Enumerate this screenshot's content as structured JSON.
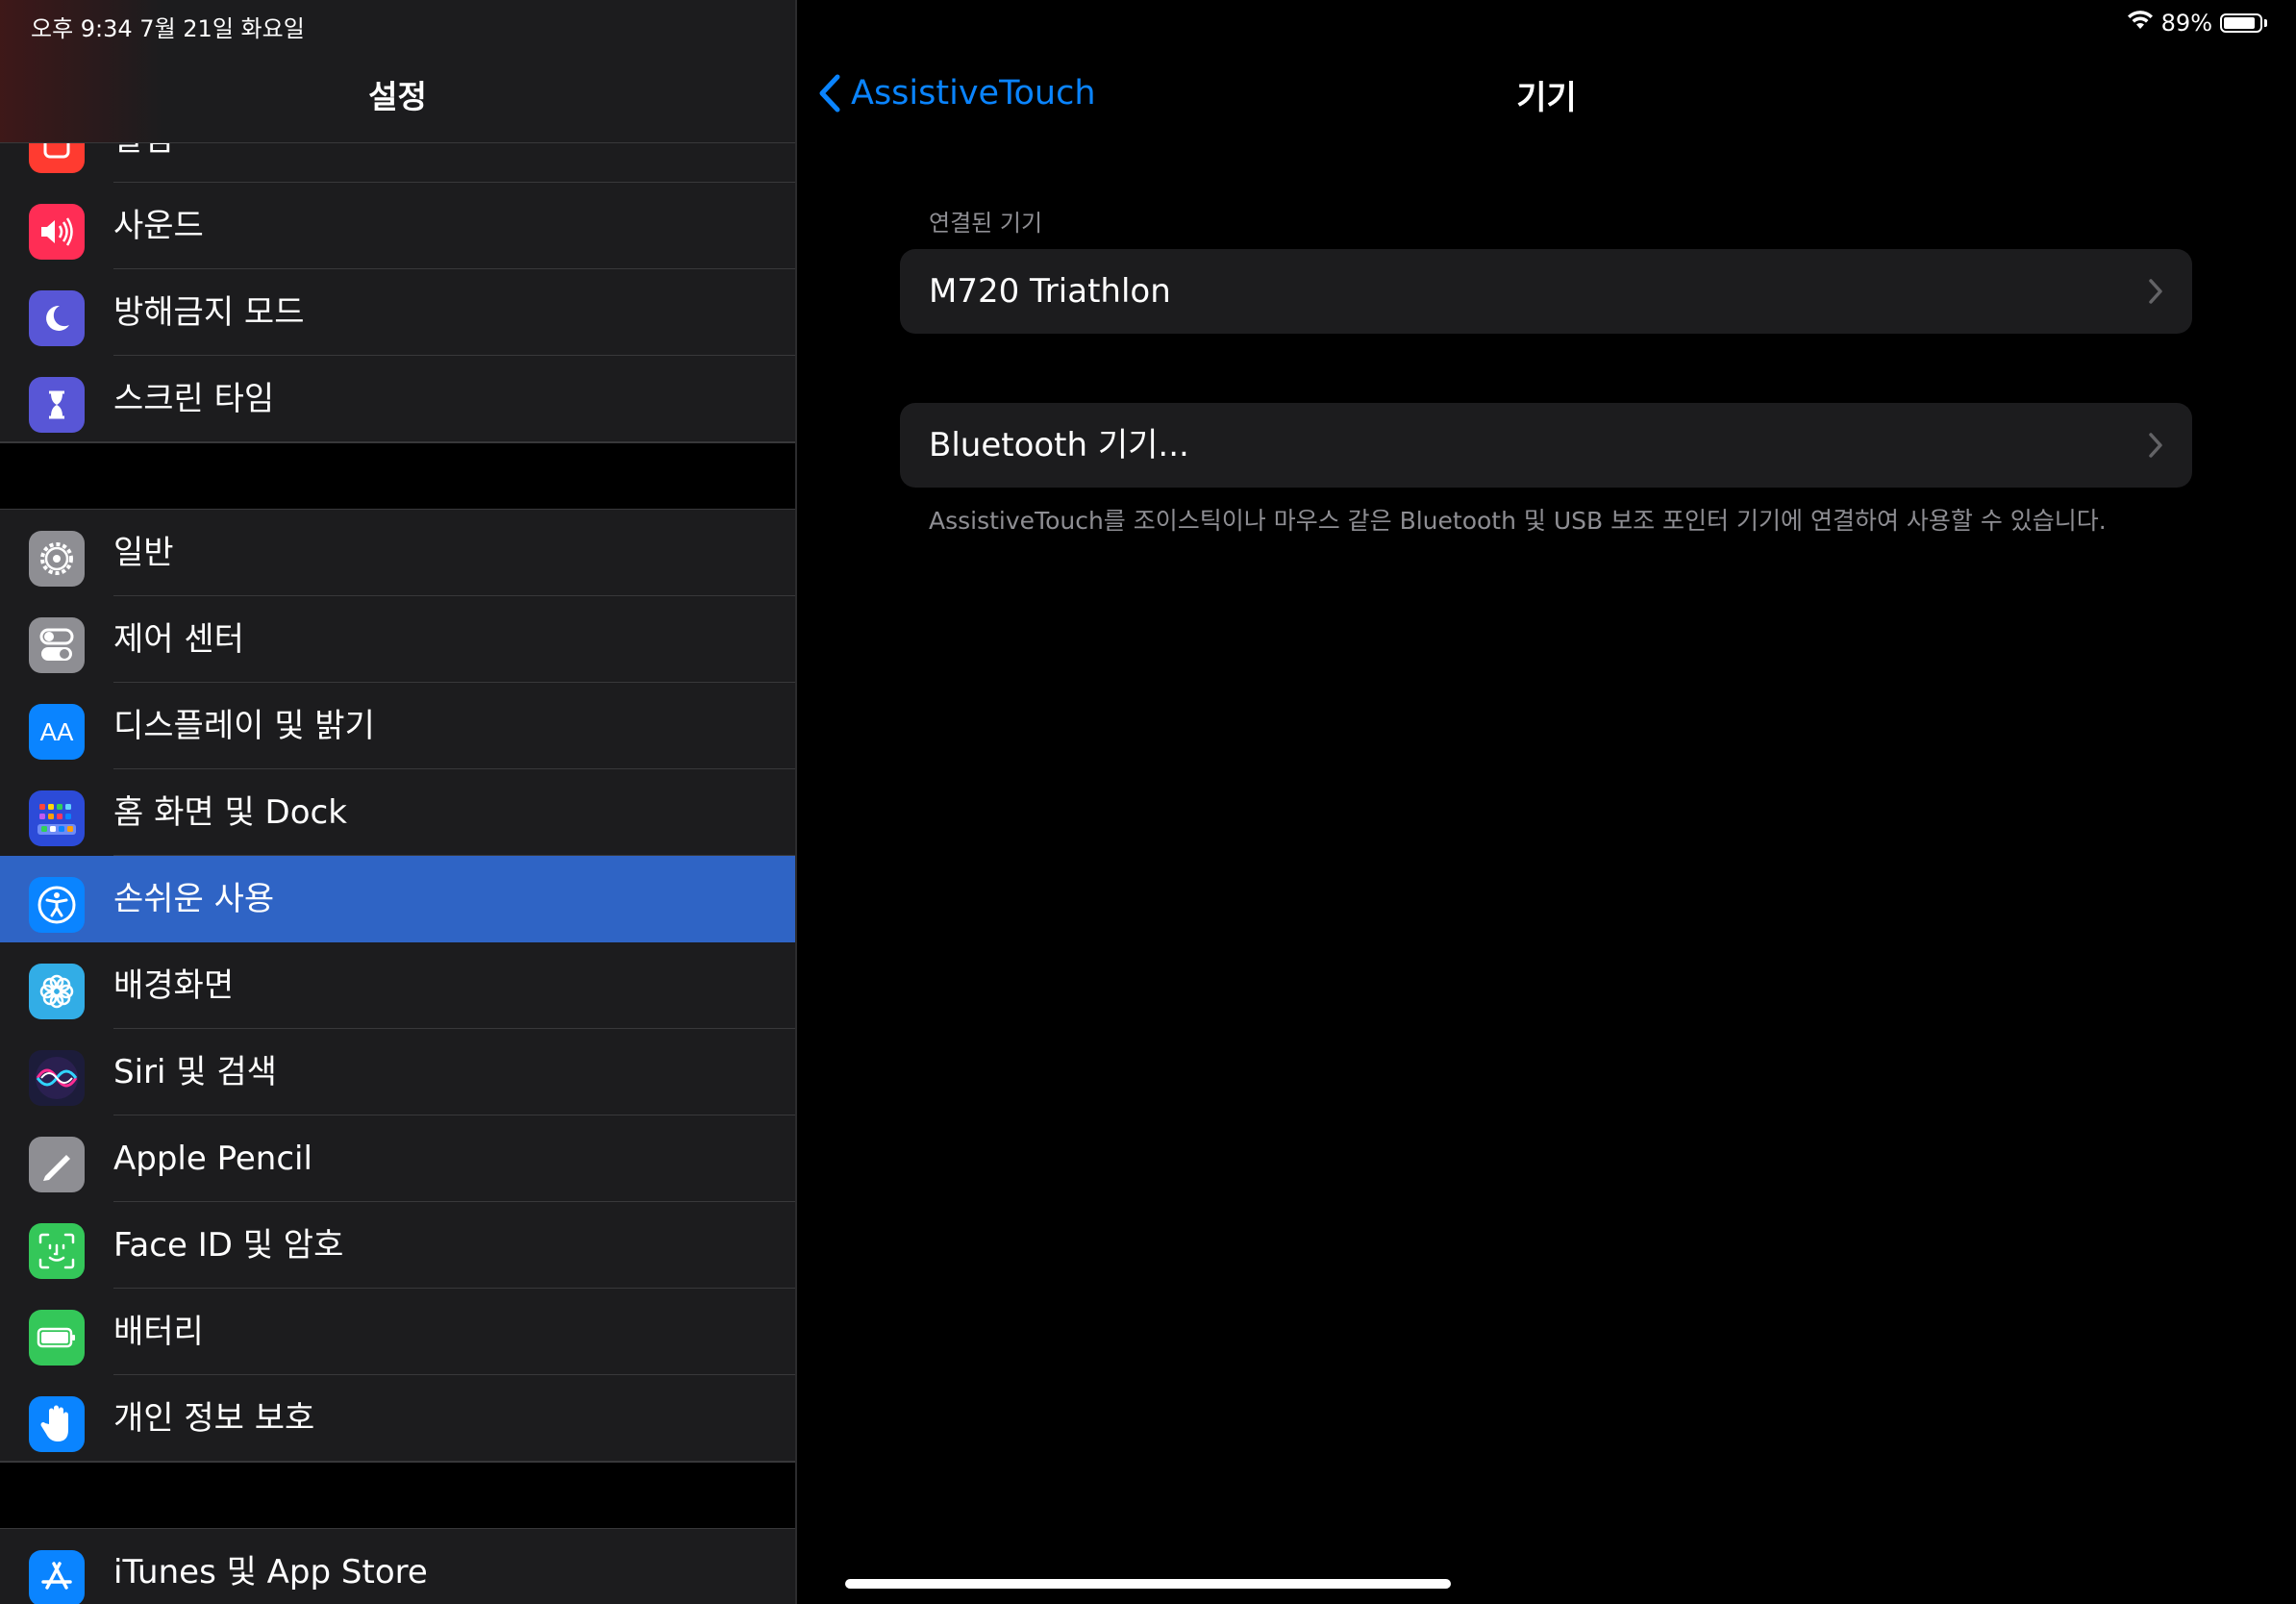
{
  "status_bar": {
    "time": "오후 9:34   7월 21일 화요일",
    "battery_percent": "89%",
    "battery_level": 0.89
  },
  "sidebar": {
    "title": "설정",
    "items": [
      {
        "label": "알림",
        "icon": "bell-icon",
        "color": "#ff3b30"
      },
      {
        "label": "사운드",
        "icon": "speaker-icon",
        "color": "#ff2d55"
      },
      {
        "label": "방해금지 모드",
        "icon": "moon-icon",
        "color": "#5856d6"
      },
      {
        "label": "스크린 타임",
        "icon": "hourglass-icon",
        "color": "#5856d6"
      },
      {
        "label": "일반",
        "icon": "gear-icon",
        "color": "#8e8e93"
      },
      {
        "label": "제어 센터",
        "icon": "toggles-icon",
        "color": "#8e8e93"
      },
      {
        "label": "디스플레이 및 밝기",
        "icon": "text-size-icon",
        "glyph": "AA",
        "color": "#0a84ff"
      },
      {
        "label": "홈 화면 및 Dock",
        "icon": "app-grid-icon",
        "color": "#2c4bd8"
      },
      {
        "label": "손쉬운 사용",
        "icon": "accessibility-icon",
        "color": "#0a84ff",
        "selected": true
      },
      {
        "label": "배경화면",
        "icon": "flower-icon",
        "color": "#32ade6"
      },
      {
        "label": "Siri 및 검색",
        "icon": "siri-icon",
        "color": "#1c1c3a"
      },
      {
        "label": "Apple Pencil",
        "icon": "pencil-icon",
        "color": "#8e8e93"
      },
      {
        "label": "Face ID 및 암호",
        "icon": "face-id-icon",
        "color": "#34c759"
      },
      {
        "label": "배터리",
        "icon": "battery-icon",
        "color": "#34c759"
      },
      {
        "label": "개인 정보 보호",
        "icon": "hand-icon",
        "color": "#0a84ff"
      },
      {
        "label": "iTunes 및 App Store",
        "icon": "app-store-icon",
        "color": "#0a84ff"
      }
    ]
  },
  "detail": {
    "back_label": "AssistiveTouch",
    "title": "기기",
    "section_header": "연결된 기기",
    "connected_device": "M720 Triathlon",
    "bluetooth_label": "Bluetooth 기기...",
    "footer": "AssistiveTouch를 조이스틱이나 마우스 같은 Bluetooth 및 USB 보조 포인터 기기에 연결하여 사용할 수 있습니다."
  },
  "colors": {
    "accent": "#0a84ff",
    "selected_row": "#2f64c5",
    "cell_bg": "#1c1c1e",
    "secondary_text": "#8e8e93"
  }
}
